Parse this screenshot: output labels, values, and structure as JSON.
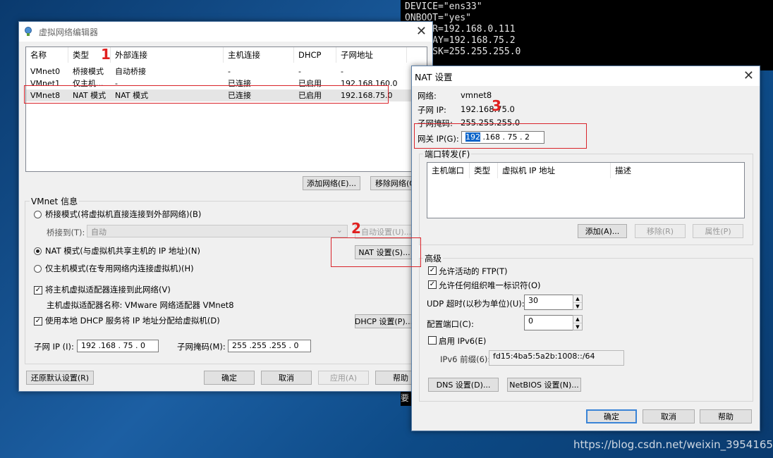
{
  "terminal": {
    "lines": [
      "DEVICE=\"ens33\"",
      "ONBOOT=\"yes\"",
      "     R=192.168.0.111",
      "     AY=192.168.75.2",
      "     SK=255.255.255.0"
    ],
    "bottom_char": "要"
  },
  "vne": {
    "title": "虚拟网络编辑器",
    "columns": [
      "名称",
      "类型",
      "外部连接",
      "主机连接",
      "DHCP",
      "子网地址"
    ],
    "rows": [
      [
        "VMnet0",
        "桥接模式",
        "自动桥接",
        "-",
        "-",
        "-"
      ],
      [
        "VMnet1",
        "仅主机...",
        "-",
        "已连接",
        "已启用",
        "192.168.160.0"
      ],
      [
        "VMnet8",
        "NAT 模式",
        "NAT 模式",
        "已连接",
        "已启用",
        "192.168.75.0"
      ]
    ],
    "add_network": "添加网络(E)...",
    "remove_network": "移除网络(O)",
    "info_title": "VMnet 信息",
    "bridged_radio": "桥接模式(将虚拟机直接连接到外部网络)(B)",
    "bridged_to_label": "桥接到(T):",
    "bridged_to_value": "自动",
    "auto_settings": "自动设置(U)...",
    "nat_radio": "NAT 模式(与虚拟机共享主机的 IP 地址)(N)",
    "nat_settings": "NAT 设置(S)...",
    "hostonly_radio": "仅主机模式(在专用网络内连接虚拟机)(H)",
    "connect_adapter": "将主机虚拟适配器连接到此网络(V)",
    "adapter_name_label": "主机虚拟适配器名称: VMware 网络适配器 VMnet8",
    "use_dhcp": "使用本地 DHCP 服务将 IP 地址分配给虚拟机(D)",
    "dhcp_settings": "DHCP 设置(P)...",
    "subnet_ip_label": "子网 IP (I):",
    "subnet_ip_value": "192 .168 . 75 . 0",
    "subnet_mask_label": "子网掩码(M):",
    "subnet_mask_value": "255 .255 .255 . 0",
    "restore": "还原默认设置(R)",
    "ok": "确定",
    "cancel": "取消",
    "apply": "应用(A)",
    "help": "帮助"
  },
  "nat": {
    "title": "NAT 设置",
    "network_label": "网络:",
    "network_value": "vmnet8",
    "subnet_ip_label": "子网 IP:",
    "subnet_ip_value": "192.168.75.0",
    "mask_label": "子网掩码:",
    "mask_value": "255.255.255.0",
    "gateway_label": "网关 IP(G):",
    "gateway_selected": "192",
    "gateway_rest": " .168 . 75 . 2",
    "port_fwd_title": "端口转发(F)",
    "port_columns": [
      "主机端口",
      "类型",
      "虚拟机 IP 地址",
      "描述"
    ],
    "add": "添加(A)...",
    "remove": "移除(R)",
    "properties": "属性(P)",
    "advanced_title": "高级",
    "allow_ftp": "允许活动的 FTP(T)",
    "allow_oui": "允许任何组织唯一标识符(O)",
    "udp_label": "UDP 超时(以秒为单位)(U):",
    "udp_value": "30",
    "config_port_label": "配置端口(C):",
    "config_port_value": "0",
    "enable_ipv6": "启用 IPv6(E)",
    "ipv6_prefix_label": "IPv6 前缀(6):",
    "ipv6_prefix_value": "fd15:4ba5:5a2b:1008::/64",
    "dns": "DNS 设置(D)...",
    "netbios": "NetBIOS 设置(N)...",
    "ok": "确定",
    "cancel": "取消",
    "help": "帮助"
  },
  "annotations": {
    "n1": "1",
    "n2": "2",
    "n3": "3"
  },
  "watermark": "https://blog.csdn.net/weixin_39541657"
}
